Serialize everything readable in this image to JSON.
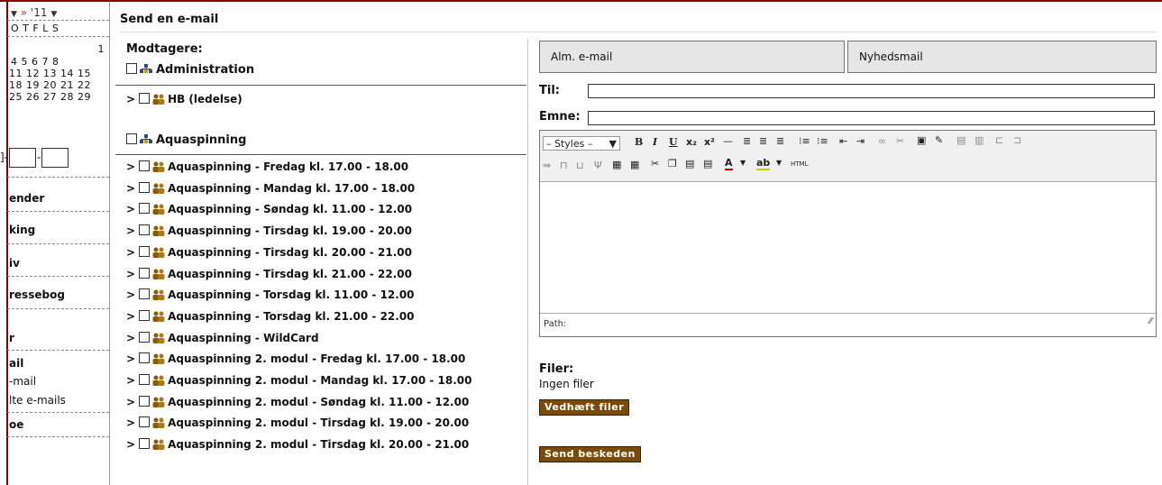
{
  "sidebar": {
    "calendar": {
      "prev_label": "▼",
      "next_label": "»",
      "year": "'11",
      "year_dropdown": "▼",
      "weekdays": "O  T  F  L  S",
      "rows": [
        "1",
        "4  5  6  7  8",
        "11 12 13 14 15",
        "18 19 20 21 22",
        "25 26 27 28 29"
      ]
    },
    "date_sep1": "]-",
    "date_sep2": "-",
    "nav": [
      {
        "label": "ender"
      },
      {
        "label": "king"
      },
      {
        "label": "iv"
      },
      {
        "label": "ressebog"
      },
      {
        "label": "r"
      },
      {
        "label": "ail"
      }
    ],
    "sub": [
      {
        "label": "-mail"
      },
      {
        "label": "lte e-mails"
      }
    ],
    "last_item": "oe"
  },
  "page": {
    "title": "Send en e-mail"
  },
  "recipients": {
    "title": "Modtagere:",
    "groups": [
      {
        "label": "Administration",
        "items": [
          "HB (ledelse)"
        ]
      },
      {
        "label": "Aquaspinning",
        "items": [
          "Aquaspinning - Fredag kl. 17.00 - 18.00",
          "Aquaspinning - Mandag kl. 17.00 - 18.00",
          "Aquaspinning - Søndag kl. 11.00 - 12.00",
          "Aquaspinning - Tirsdag kl. 19.00 - 20.00",
          "Aquaspinning - Tirsdag kl. 20.00 - 21.00",
          "Aquaspinning - Tirsdag kl. 21.00 - 22.00",
          "Aquaspinning - Torsdag kl. 11.00 - 12.00",
          "Aquaspinning - Torsdag kl. 21.00 - 22.00",
          "Aquaspinning - WildCard",
          "Aquaspinning 2. modul - Fredag kl. 17.00 - 18.00",
          "Aquaspinning 2. modul - Mandag kl. 17.00 - 18.00",
          "Aquaspinning 2. modul - Søndag kl. 11.00 - 12.00",
          "Aquaspinning 2. modul - Tirsdag kl. 19.00 - 20.00",
          "Aquaspinning 2. modul - Tirsdag kl. 20.00 - 21.00"
        ]
      }
    ]
  },
  "form": {
    "tabs": [
      {
        "label": "Alm. e-mail"
      },
      {
        "label": "Nyhedsmail"
      }
    ],
    "to_label": "Til:",
    "to_value": "",
    "subject_label": "Emne:",
    "subject_value": "",
    "editor": {
      "styles_label": "– Styles –",
      "styles_arrow": "▼",
      "html_label": "HTML",
      "path_label": "Path:",
      "body": ""
    },
    "files_title": "Filer:",
    "files_none": "Ingen filer",
    "attach_button": "Vedhæft filer",
    "send_button": "Send beskeden"
  },
  "colors": {
    "accent": "#8b0000",
    "button_bg": "#7a4a08",
    "tab_bg": "#e6e6e6"
  }
}
